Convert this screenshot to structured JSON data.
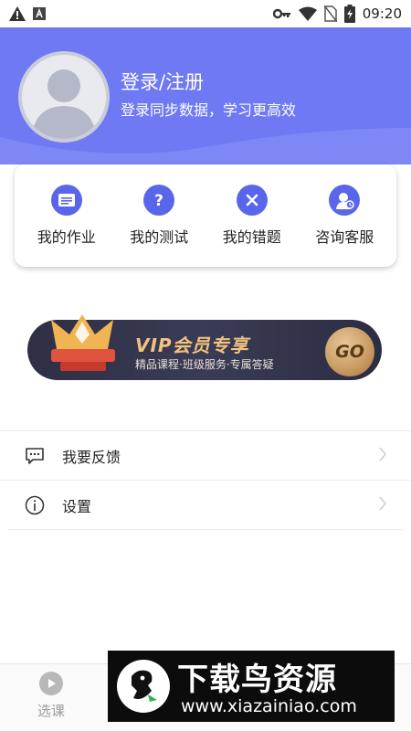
{
  "status_bar": {
    "time": "09:20",
    "left_icons": [
      "warning-icon",
      "a-box-icon"
    ],
    "right_icons": [
      "key-icon",
      "wifi-icon",
      "no-sim-icon",
      "battery-icon"
    ]
  },
  "header": {
    "title": "登录/注册",
    "subtitle": "登录同步数据，学习更高效",
    "bg_color": "#6e79f3"
  },
  "quick_actions": [
    {
      "label": "我的作业",
      "icon": "homework-icon"
    },
    {
      "label": "我的测试",
      "icon": "question-icon"
    },
    {
      "label": "我的错题",
      "icon": "close-icon"
    },
    {
      "label": "咨询客服",
      "icon": "customer-service-icon"
    }
  ],
  "vip_banner": {
    "title": "VIP会员专享",
    "subtitle": "精品课程·班级服务·专属答疑",
    "cta": "GO"
  },
  "menu": [
    {
      "label": "我要反馈",
      "icon": "feedback-icon"
    },
    {
      "label": "设置",
      "icon": "info-icon"
    }
  ],
  "tab_bar": {
    "items": [
      {
        "label": "选课",
        "icon": "play-icon"
      }
    ]
  },
  "watermark": {
    "title": "下载鸟资源",
    "url": "www.xiazainiao.com"
  },
  "colors": {
    "accent": "#5a66ea",
    "vip_gold": "#f2c27f"
  }
}
